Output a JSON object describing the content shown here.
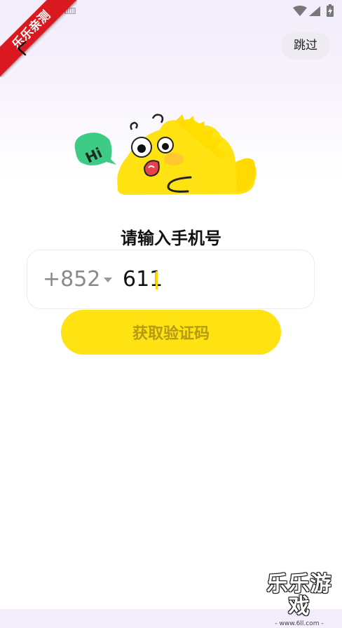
{
  "status_bar": {
    "icons": [
      "keyboard-icon",
      "wifi-icon",
      "cellular-signal-icon",
      "battery-charging-icon"
    ]
  },
  "ribbon": {
    "text": "乐乐亲测"
  },
  "header": {
    "back_icon": "back-arrow-icon",
    "skip_label": "跳过"
  },
  "mascot": {
    "bubble_text": "Hi"
  },
  "main": {
    "title": "请输入手机号",
    "country_code": "+852",
    "phone_value": "611",
    "get_code_label": "获取验证码"
  },
  "watermark": {
    "title": "乐乐游戏",
    "url": "- www.6ll.com -"
  },
  "colors": {
    "accent_yellow": "#FFE211",
    "button_text": "#B59A14",
    "ribbon_red": "#D9191F",
    "bubble_green": "#3DCB86"
  }
}
